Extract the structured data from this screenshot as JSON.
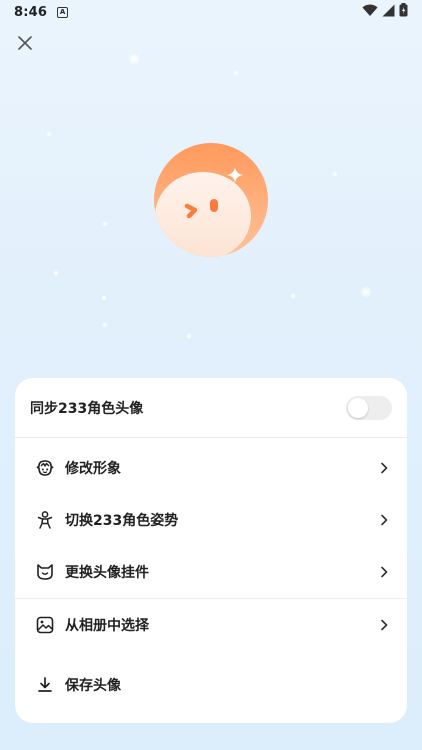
{
  "status_bar": {
    "time": "8:46",
    "notification_icon": "a-icon",
    "icons": [
      "wifi-icon",
      "signal-icon",
      "battery-icon"
    ]
  },
  "header": {
    "close_icon": "close-icon"
  },
  "avatar": {
    "icon": "avatar-face-icon",
    "colors": {
      "top": "#ffa46a",
      "bottom": "#fde7da"
    }
  },
  "sheet": {
    "sync": {
      "label": "同步233角色头像",
      "toggle_on": false
    },
    "items": [
      {
        "label": "修改形象",
        "icon": "character-face-icon",
        "has_chevron": true
      },
      {
        "label": "切换233角色姿势",
        "icon": "pose-figure-icon",
        "has_chevron": true
      },
      {
        "label": "更换头像挂件",
        "icon": "cat-face-icon",
        "has_chevron": true
      },
      {
        "label": "从相册中选择",
        "icon": "image-gallery-icon",
        "has_chevron": true
      },
      {
        "label": "保存头像",
        "icon": "download-icon",
        "has_chevron": false
      }
    ]
  }
}
